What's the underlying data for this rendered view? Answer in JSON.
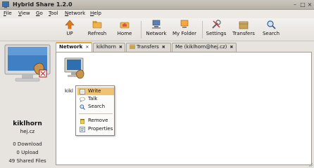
{
  "window": {
    "title": "Hybrid Share 1.2.0"
  },
  "menus": [
    {
      "label": "File",
      "mnemonic": "F",
      "rest": "ile"
    },
    {
      "label": "View",
      "mnemonic": "V",
      "rest": "iew"
    },
    {
      "label": "Go",
      "mnemonic": "G",
      "rest": "o"
    },
    {
      "label": "Tool",
      "mnemonic": "T",
      "rest": "ool"
    },
    {
      "label": "Network",
      "mnemonic": "N",
      "rest": "etwork"
    },
    {
      "label": "Help",
      "mnemonic": "H",
      "rest": "elp"
    }
  ],
  "toolbar": [
    {
      "label": "UP",
      "icon": "up-arrow-icon"
    },
    {
      "label": "Refresh",
      "icon": "refresh-icon"
    },
    {
      "label": "Home",
      "icon": "home-folder-icon"
    },
    {
      "label": "Network",
      "icon": "network-icon"
    },
    {
      "label": "My Folder",
      "icon": "my-folder-icon"
    },
    {
      "label": "Settings",
      "icon": "settings-icon"
    },
    {
      "label": "Transfers",
      "icon": "transfers-icon"
    },
    {
      "label": "Search",
      "icon": "search-icon"
    }
  ],
  "user": {
    "name": "kiklhorn",
    "host": "hej.cz",
    "downloads": "0 Download",
    "uploads": "0 Upload",
    "shared": "49 Shared Files"
  },
  "tabs": [
    {
      "label": "Network",
      "active": true
    },
    {
      "label": "kiklhorn",
      "active": false
    },
    {
      "label": "Transfers",
      "active": false
    },
    {
      "label": "Me (kiklhorn@hej.cz)",
      "active": false
    }
  ],
  "share": {
    "label": "kikl"
  },
  "context_menu": [
    {
      "label": "Write",
      "icon": "write-icon",
      "highlighted": true
    },
    {
      "label": "Talk",
      "icon": "talk-icon",
      "highlighted": false
    },
    {
      "label": "Search",
      "icon": "search-icon",
      "highlighted": false
    },
    {
      "label": "Remove",
      "icon": "trash-icon",
      "highlighted": false
    },
    {
      "label": "Properties",
      "icon": "properties-icon",
      "highlighted": false
    }
  ],
  "colors": {
    "accent": "#e8a23c",
    "highlight": "#efc276"
  }
}
